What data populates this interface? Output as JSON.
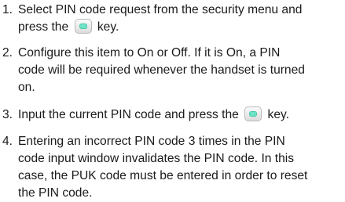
{
  "steps": [
    {
      "number": "1.",
      "lines": [
        "Select PIN code request from the security menu and",
        "press the",
        "key."
      ],
      "icon": "ok-key-icon"
    },
    {
      "number": "2.",
      "lines": [
        "Configure this item to On or Off. If it is On, a PIN",
        "code will be required whenever the handset is turned",
        "on."
      ]
    },
    {
      "number": "3.",
      "lines": [
        "Input the current PIN code and press the",
        "key."
      ],
      "icon": "ok-key-icon"
    },
    {
      "number": "4.",
      "lines": [
        "Entering an incorrect PIN code 3 times in the PIN",
        "code input window invalidates the PIN code. In this",
        "case, the PUK code must be entered in order to reset",
        "the PIN code."
      ]
    }
  ],
  "colors": {
    "text": "#1a1a1a",
    "key_accent": "#6fe3c6"
  }
}
